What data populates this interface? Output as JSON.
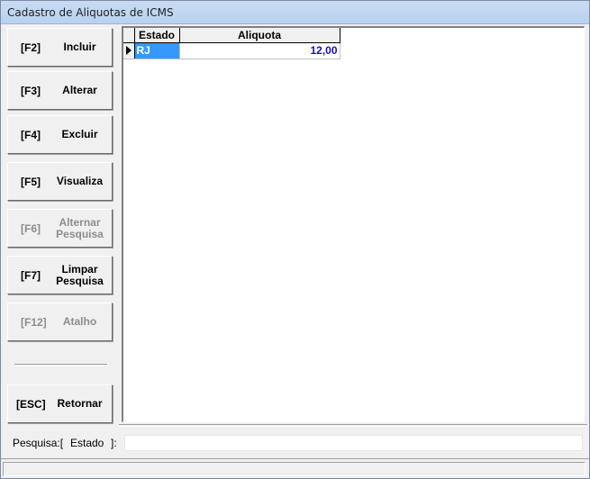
{
  "window": {
    "title": "Cadastro de Aliquotas de ICMS"
  },
  "buttons": [
    {
      "key": "[F2]",
      "label": "Incluir",
      "enabled": true
    },
    {
      "key": "[F3]",
      "label": "Alterar",
      "enabled": true
    },
    {
      "key": "[F4]",
      "label": "Excluir",
      "enabled": true
    },
    {
      "key": "[F5]",
      "label": "Visualiza",
      "enabled": true
    },
    {
      "key": "[F6]",
      "label": "Alternar Pesquisa",
      "enabled": false
    },
    {
      "key": "[F7]",
      "label": "Limpar Pesquisa",
      "enabled": true
    },
    {
      "key": "[F12]",
      "label": "Atalho",
      "enabled": false
    },
    {
      "key": "[ESC]",
      "label": "Retornar",
      "enabled": true
    }
  ],
  "grid": {
    "columns": [
      "Estado",
      "Aliquota"
    ],
    "rows": [
      {
        "estado": "RJ",
        "aliquota": "12,00"
      }
    ]
  },
  "search": {
    "label": "Pesquisa:[",
    "field": "Estado",
    "close": "]:",
    "value": ""
  },
  "status": {
    "text": ""
  }
}
